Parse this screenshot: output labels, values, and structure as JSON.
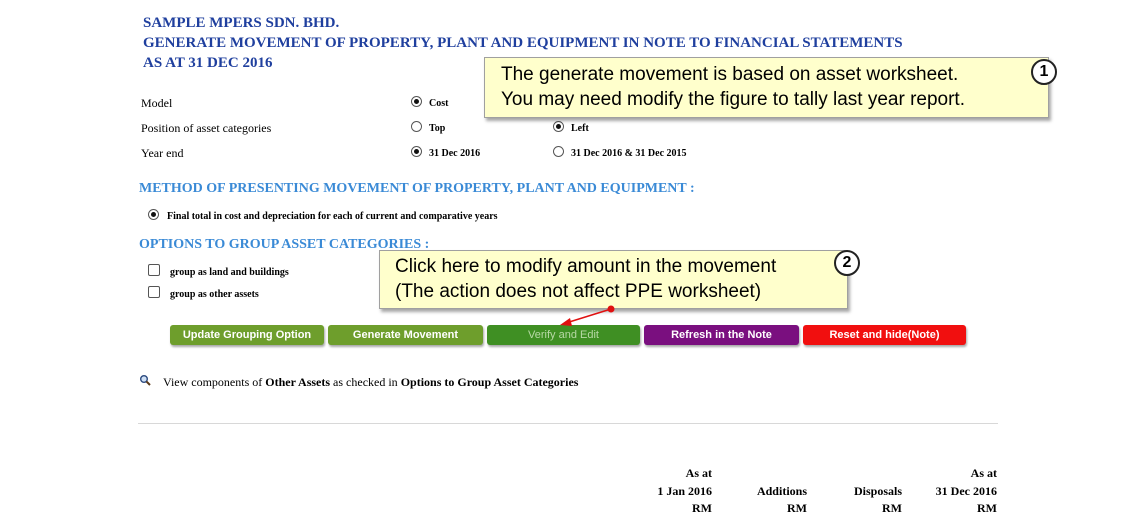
{
  "header": {
    "company": "SAMPLE MPERS SDN. BHD.",
    "title": "GENERATE MOVEMENT OF PROPERTY, PLANT AND EQUIPMENT IN NOTE TO FINANCIAL STATEMENTS",
    "date": "AS AT 31 DEC 2016"
  },
  "settings": {
    "model": {
      "label": "Model",
      "option1": "Cost"
    },
    "position": {
      "label": "Position of asset categories",
      "option1": "Top",
      "option2": "Left"
    },
    "year_end": {
      "label": "Year end",
      "option1": "31 Dec 2016",
      "option2": "31 Dec 2016 & 31 Dec 2015"
    }
  },
  "method": {
    "heading": "METHOD OF PRESENTING MOVEMENT OF PROPERTY, PLANT AND EQUIPMENT :",
    "option1": "Final total in cost and depreciation for each of current and comparative years"
  },
  "grouping": {
    "heading": "OPTIONS TO GROUP ASSET CATEGORIES :",
    "option1": "group as land and buildings",
    "option2": "group as other assets"
  },
  "buttons": {
    "update": "Update Grouping Option",
    "generate": "Generate Movement",
    "verify": "Verify and Edit",
    "refresh": "Refresh in the Note",
    "reset": "Reset and hide(Note)"
  },
  "view_link": {
    "prefix": "View components of ",
    "bold1": "Other Assets",
    "middle": " as checked in ",
    "bold2": "Options to Group Asset Categories"
  },
  "callouts": [
    {
      "number": "1",
      "line1": "The generate movement is based on asset worksheet.",
      "line2": "You may need modify the figure to tally last year report."
    },
    {
      "number": "2",
      "line1": "Click here to modify amount in the movement",
      "line2": "(The action does not affect PPE worksheet)"
    }
  ],
  "table_header": {
    "col1": {
      "l1": "As at",
      "l2": "1 Jan 2016",
      "l3": "RM"
    },
    "col2": {
      "l2": "Additions",
      "l3": "RM"
    },
    "col3": {
      "l2": "Disposals",
      "l3": "RM"
    },
    "col4": {
      "l1": "As at",
      "l2": "31 Dec 2016",
      "l3": "RM"
    }
  },
  "colors": {
    "header_blue": "#1f3f9e",
    "section_blue": "#3a8ad6",
    "btn_green": "#6e9e2c",
    "btn_green_dark": "#3f8f23",
    "btn_purple": "#7a0f7f",
    "btn_red": "#f10f0f",
    "callout_bg": "#ffffcc"
  }
}
